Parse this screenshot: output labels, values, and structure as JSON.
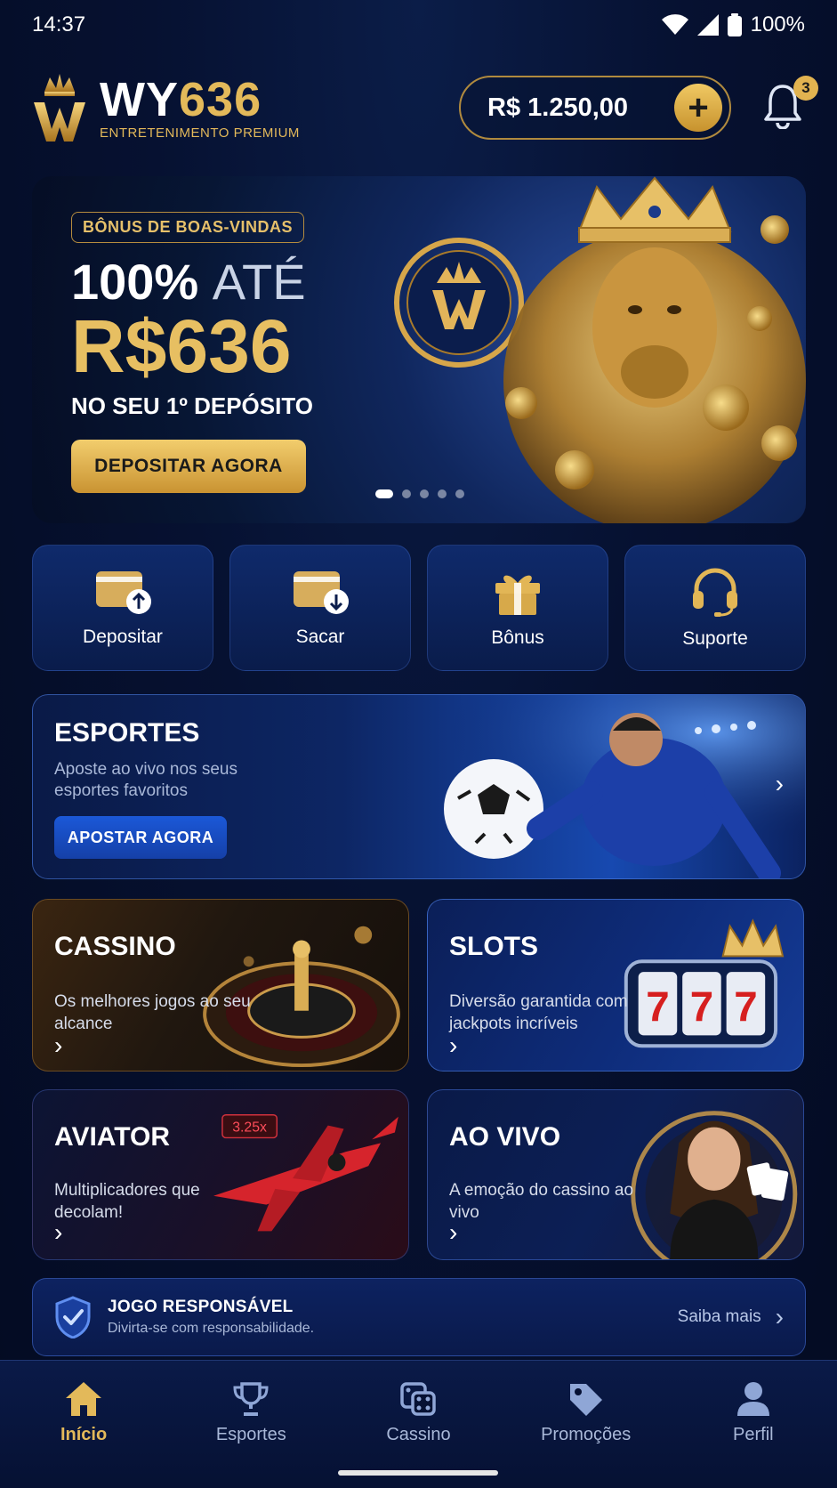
{
  "status_bar": {
    "time": "14:37",
    "battery": "100%"
  },
  "header": {
    "logo_prefix": "WY",
    "logo_number": "636",
    "tagline": "ENTRETENIMENTO PREMIUM",
    "balance": "R$ 1.250,00",
    "add_symbol": "+",
    "notification_count": "3"
  },
  "hero": {
    "tag": "BÔNUS DE BOAS-VINDAS",
    "line1_a": "100%",
    "line1_b": "ATÉ",
    "amount": "R$636",
    "subtitle": "NO SEU 1º DEPÓSITO",
    "cta": "DEPOSITAR AGORA",
    "slides": 5,
    "active_slide": 1
  },
  "quick_actions": [
    {
      "label": "Depositar",
      "icon": "wallet-deposit-icon"
    },
    {
      "label": "Sacar",
      "icon": "wallet-withdraw-icon"
    },
    {
      "label": "Bônus",
      "icon": "gift-icon"
    },
    {
      "label": "Suporte",
      "icon": "headset-icon"
    }
  ],
  "sports": {
    "title": "ESPORTES",
    "description": "Aposte ao vivo nos seus esportes favoritos",
    "cta": "APOSTAR AGORA"
  },
  "games": {
    "casino": {
      "title": "CASSINO",
      "description": "Os melhores jogos ao seu alcance"
    },
    "slots": {
      "title": "SLOTS",
      "description": "Diversão garantida com jackpots incríveis"
    },
    "aviator": {
      "title": "AVIATOR",
      "description": "Multiplicadores que decolam!",
      "multiplier": "3.25x"
    },
    "aovivo": {
      "title": "AO VIVO",
      "description": "A emoção do cassino ao vivo"
    }
  },
  "responsible": {
    "title": "JOGO RESPONSÁVEL",
    "subtitle": "Divirta-se com responsabilidade.",
    "link": "Saiba mais"
  },
  "bottom_nav": [
    {
      "label": "Início",
      "icon": "home-icon",
      "active": true
    },
    {
      "label": "Esportes",
      "icon": "trophy-icon",
      "active": false
    },
    {
      "label": "Cassino",
      "icon": "dice-icon",
      "active": false
    },
    {
      "label": "Promoções",
      "icon": "tag-icon",
      "active": false
    },
    {
      "label": "Perfil",
      "icon": "user-icon",
      "active": false
    }
  ],
  "colors": {
    "gold": "#e3b95a",
    "navy": "#061131",
    "blue_accent": "#1b58d8"
  }
}
